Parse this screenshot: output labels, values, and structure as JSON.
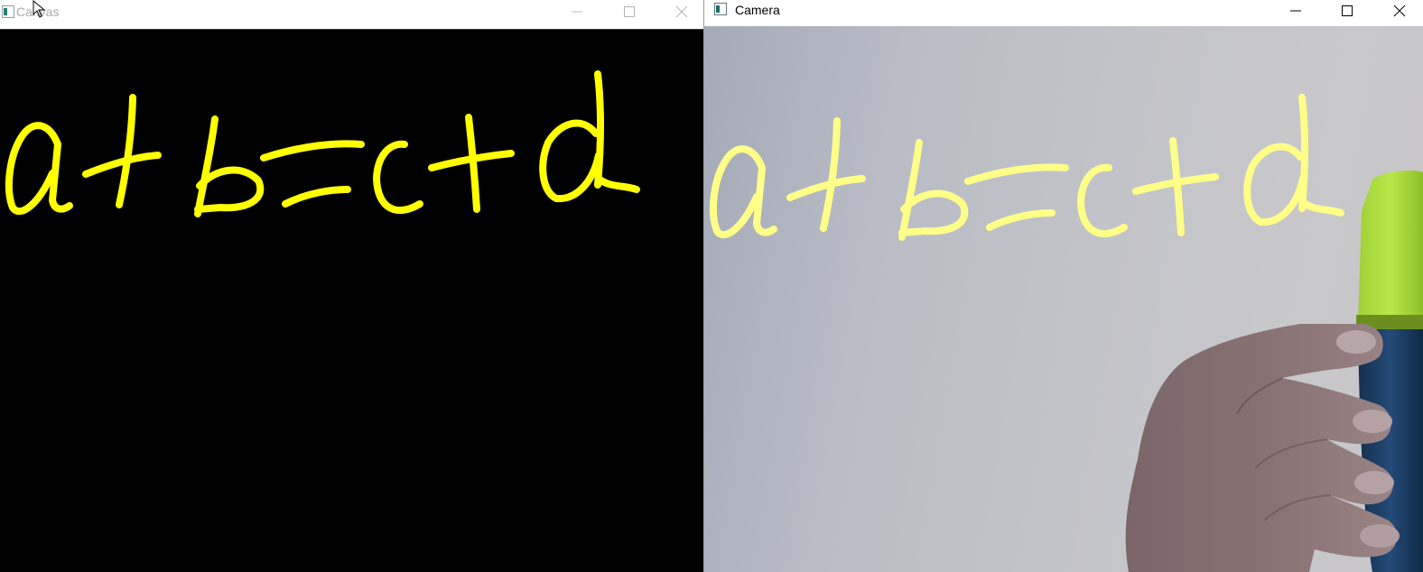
{
  "canvas_window": {
    "title": "Canvas",
    "stroke_color": "#ffff00",
    "background_color": "#000000",
    "focused": false
  },
  "camera_window": {
    "title": "Camera",
    "stroke_color": "#ffff88",
    "focused": true
  },
  "icons": {
    "app": "opencv-window-icon",
    "minimize": "minimize-icon",
    "maximize": "maximize-icon",
    "close": "close-icon"
  }
}
